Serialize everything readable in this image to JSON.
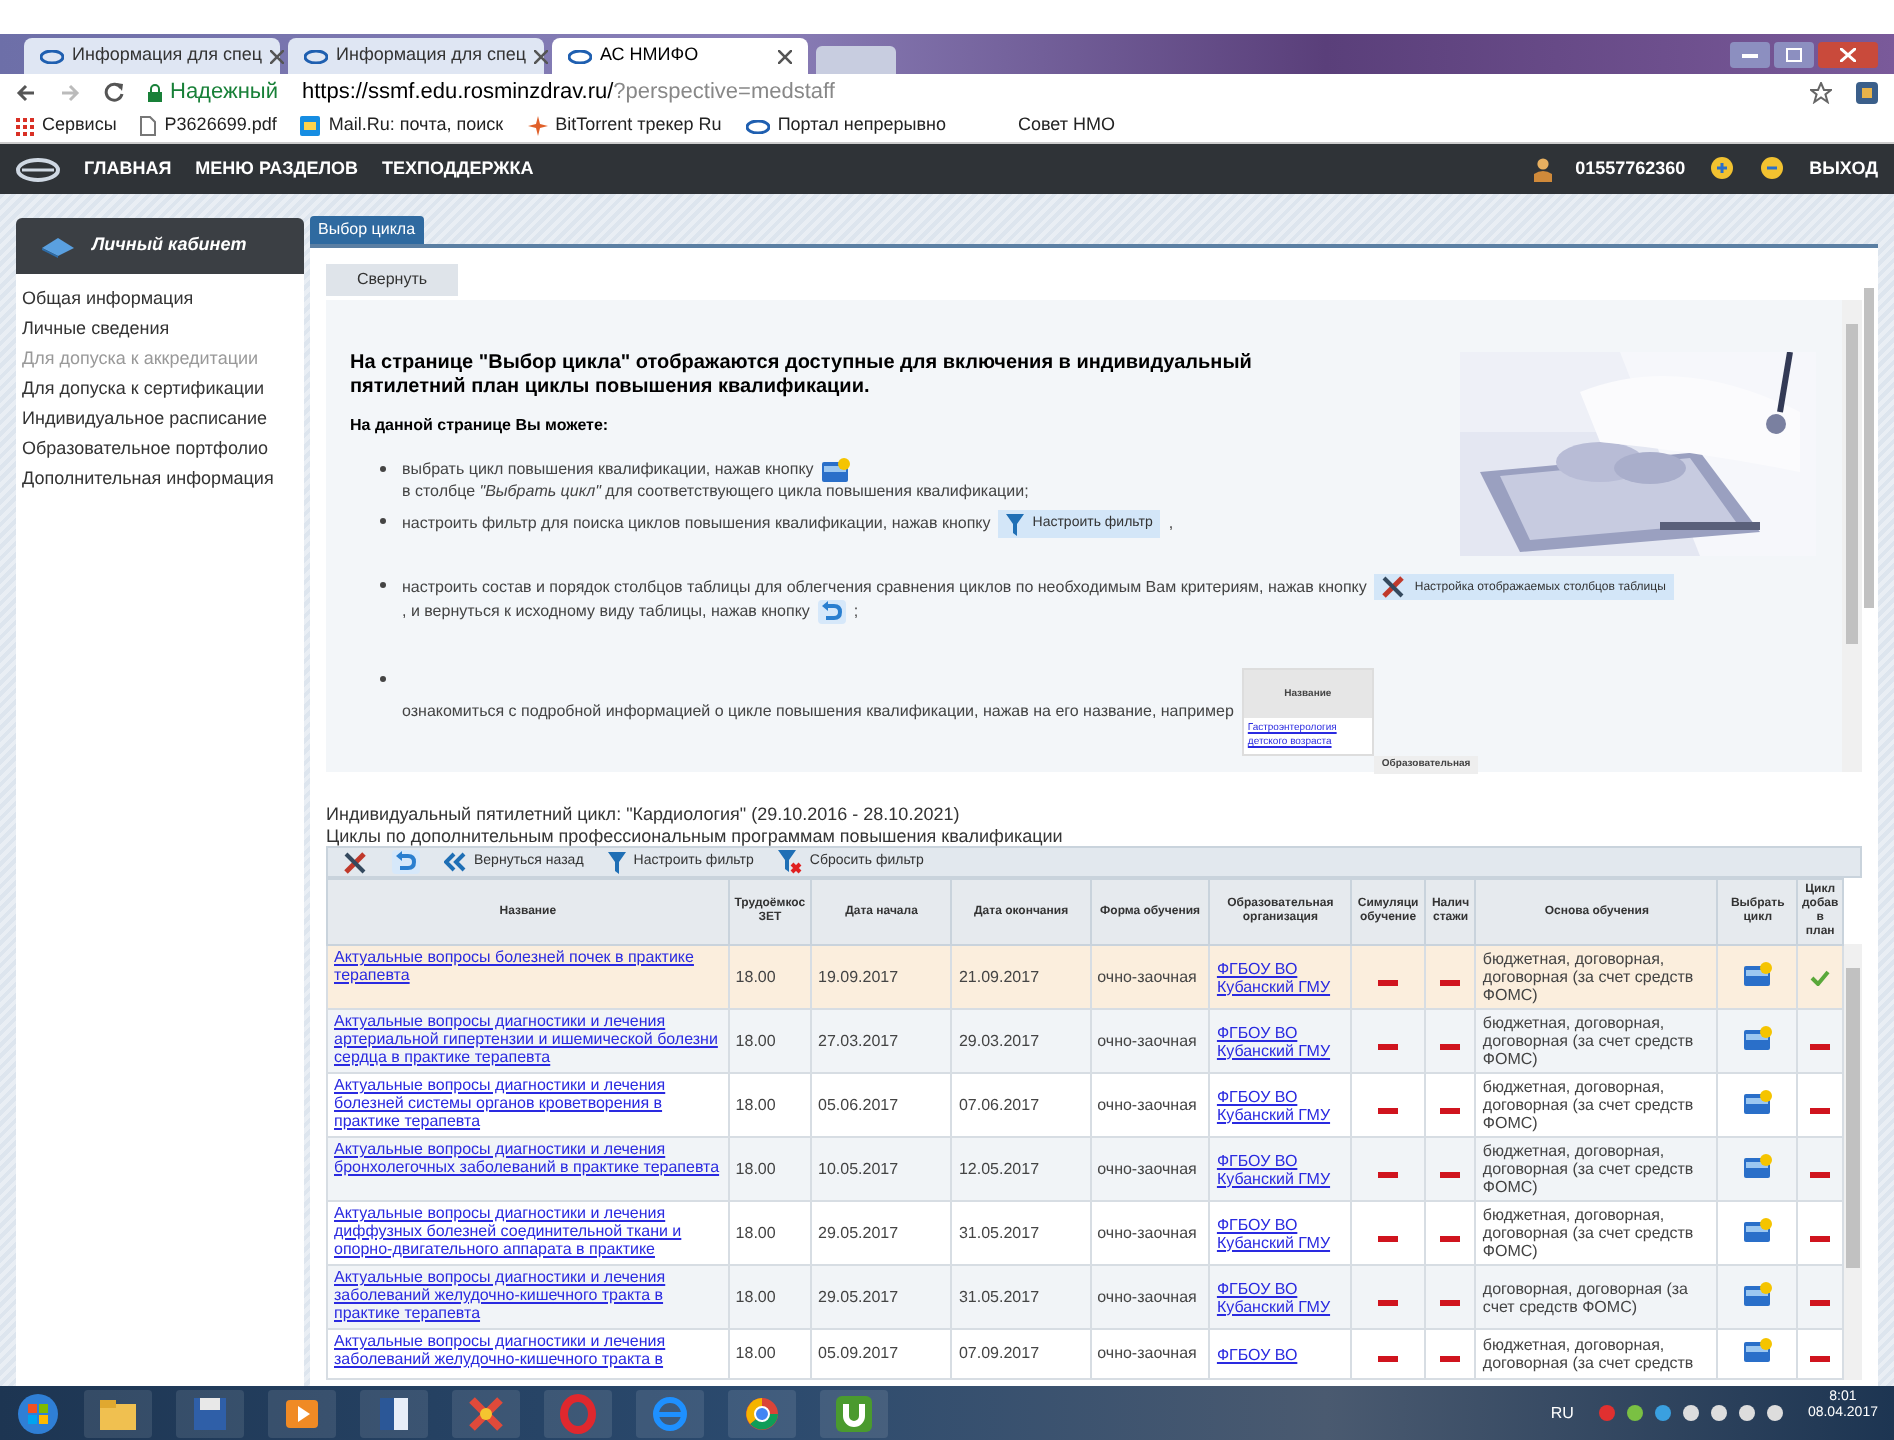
{
  "browser": {
    "tabs": [
      {
        "label": "Информация для спец",
        "selected": false
      },
      {
        "label": "Информация для спец",
        "selected": false
      },
      {
        "label": "АС НМИФО",
        "selected": true
      }
    ],
    "secure_label": "Надежный",
    "url": "https://ssmf.edu.rosminzdrav.ru/",
    "url_rest": "?perspective=medstaff",
    "bookmarks": [
      "Сервисы",
      "P3626699.pdf",
      "Mail.Ru: почта, поиск",
      "BitTorrent трекер Ru",
      "Портал непрерывно",
      "Совет НМО"
    ]
  },
  "nav": {
    "items": [
      "ГЛАВНАЯ",
      "МЕНЮ РАЗДЕЛОВ",
      "ТЕХПОДДЕРЖКА"
    ],
    "user": "01557762360",
    "logout": "ВЫХОД"
  },
  "sidebar": {
    "title": "Личный кабинет",
    "items": [
      {
        "label": "Общая информация",
        "disabled": false
      },
      {
        "label": "Личные сведения",
        "disabled": false
      },
      {
        "label": "Для допуска к аккредитации",
        "disabled": true
      },
      {
        "label": "Для допуска к сертификации",
        "disabled": false
      },
      {
        "label": "Индивидуальное расписание",
        "disabled": false
      },
      {
        "label": "Образовательное портфолио",
        "disabled": false
      },
      {
        "label": "Дополнительная информация",
        "disabled": false
      }
    ]
  },
  "page_tab": "Выбор цикла",
  "collapse_button": "Свернуть",
  "info": {
    "heading": "На странице \"Выбор цикла\" отображаются доступные для включения в индивидуальный пятилетний план циклы повышения квалификации.",
    "subheading": "На данной странице Вы можете:",
    "bullets": [
      {
        "parts": [
          {
            "kind": "text",
            "text": "выбрать цикл повышения квалификации, нажав кнопку"
          },
          {
            "kind": "select-icon"
          },
          {
            "kind": "text",
            "text": "в столбце *\"Выбрать цикл\"* для соответствующего цикла повышения квалификации;"
          }
        ]
      },
      {
        "parts": [
          {
            "kind": "text",
            "text": "настроить фильтр для поиска циклов повышения квалификации, нажав кнопку"
          },
          {
            "kind": "filter-button",
            "text": "Настроить фильтр"
          },
          {
            "kind": "text",
            "text": ","
          }
        ]
      },
      {
        "parts": [
          {
            "kind": "text",
            "text": "настроить состав и порядок столбцов таблицы для облегчения сравнения циклов по необходимым Вам критериям, нажав кнопку"
          },
          {
            "kind": "columns-button",
            "text": "Настройка отображаемых столбцов таблицы"
          },
          {
            "kind": "text",
            "text": ", и вернуться к исходному виду таблицы, нажав кнопку"
          },
          {
            "kind": "reset-icon"
          },
          {
            "kind": "text",
            "text": ";"
          }
        ]
      },
      {
        "parts": [
          {
            "kind": "text",
            "text": "ознакомиться с подробной информацией о цикле повышения квалификации, нажав на его название, например"
          },
          {
            "kind": "sample",
            "header": "Название",
            "link": "Гастроэнтерология детского возраста",
            "next": "Образовательная"
          }
        ]
      }
    ]
  },
  "caption": "Индивидуальный пятилетний цикл: \"Кардиология\" (29.10.2016 - 28.10.2021)",
  "subcaption": "Циклы по дополнительным профессиональным программам повышения квалификации",
  "toolbar": [
    {
      "kind": "columns"
    },
    {
      "kind": "reset"
    },
    {
      "kind": "back",
      "text": "Вернуться назад"
    },
    {
      "kind": "filter",
      "text": "Настроить фильтр"
    },
    {
      "kind": "clear-filter",
      "text": "Сбросить фильтр"
    }
  ],
  "table": {
    "columns": [
      "Название",
      "Трудоёмкос ЗЕТ",
      "Дата начала",
      "Дата окончания",
      "Форма обучения",
      "Образовательная организация",
      "Симуляци обучение",
      "Налич стажи",
      "Основа обучения",
      "Выбрать цикл",
      "Цикл добав в план"
    ],
    "rows": [
      {
        "selected": true,
        "name": "Актуальные вопросы болезней почек в практике терапевта",
        "zet": "18.00",
        "start": "19.09.2017",
        "end": "21.09.2017",
        "form": "очно-заочная",
        "org": "ФГБОУ ВО Кубанский ГМУ",
        "simulation": false,
        "internship": false,
        "basis": "бюджетная, договорная, договорная (за счет средств ФОМС)",
        "added": true
      },
      {
        "selected": false,
        "name": "Актуальные вопросы диагностики и лечения артериальной гипертензии и ишемической болезни сердца в практике терапевта",
        "zet": "18.00",
        "start": "27.03.2017",
        "end": "29.03.2017",
        "form": "очно-заочная",
        "org": "ФГБОУ ВО Кубанский ГМУ",
        "simulation": false,
        "internship": false,
        "basis": "бюджетная, договорная, договорная (за счет средств ФОМС)",
        "added": false
      },
      {
        "selected": false,
        "name": "Актуальные вопросы диагностики и лечения болезней системы органов кроветворения в практике терапевта",
        "zet": "18.00",
        "start": "05.06.2017",
        "end": "07.06.2017",
        "form": "очно-заочная",
        "org": "ФГБОУ ВО Кубанский ГМУ",
        "simulation": false,
        "internship": false,
        "basis": "бюджетная, договорная, договорная (за счет средств ФОМС)",
        "added": false
      },
      {
        "selected": false,
        "name": "Актуальные вопросы диагностики и лечения бронхолегочных заболеваний в практике терапевта",
        "zet": "18.00",
        "start": "10.05.2017",
        "end": "12.05.2017",
        "form": "очно-заочная",
        "org": "ФГБОУ ВО Кубанский ГМУ",
        "simulation": false,
        "internship": false,
        "basis": "бюджетная, договорная, договорная (за счет средств ФОМС)",
        "added": false
      },
      {
        "selected": false,
        "name": "Актуальные вопросы диагностики и лечения диффузных болезней соединительной ткани и опорно-двигательного аппарата в практике",
        "zet": "18.00",
        "start": "29.05.2017",
        "end": "31.05.2017",
        "form": "очно-заочная",
        "org": "ФГБОУ ВО Кубанский ГМУ",
        "simulation": false,
        "internship": false,
        "basis": "бюджетная, договорная, договорная (за счет средств ФОМС)",
        "added": false
      },
      {
        "selected": false,
        "name": "Актуальные вопросы диагностики и лечения заболеваний желудочно-кишечного тракта в практике терапевта",
        "zet": "18.00",
        "start": "29.05.2017",
        "end": "31.05.2017",
        "form": "очно-заочная",
        "org": "ФГБОУ ВО Кубанский ГМУ",
        "simulation": false,
        "internship": false,
        "basis": "договорная, договорная (за счет средств ФОМС)",
        "added": false
      },
      {
        "selected": false,
        "name": "Актуальные вопросы диагностики и лечения заболеваний желудочно-кишечного тракта в",
        "zet": "18.00",
        "start": "05.09.2017",
        "end": "07.09.2017",
        "form": "очно-заочная",
        "org": "ФГБОУ ВО",
        "simulation": false,
        "internship": false,
        "basis": "бюджетная, договорная, договорная (за счет средств",
        "added": false
      }
    ]
  },
  "taskbar": {
    "language": "RU",
    "time": "8:01",
    "date": "08.04.2017"
  }
}
